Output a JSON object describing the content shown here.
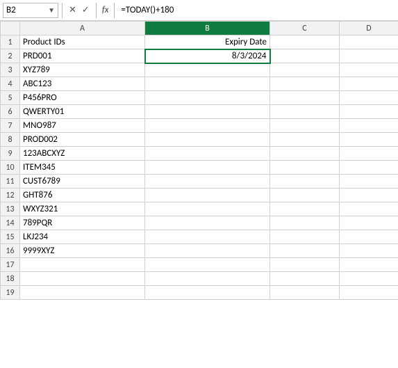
{
  "formulaBar": {
    "nameBox": "B2",
    "icons": [
      "✕",
      "✓",
      "fx"
    ],
    "formula": "=TODAY()+180"
  },
  "columns": {
    "corner": "",
    "headers": [
      "A",
      "B",
      "C",
      "D"
    ]
  },
  "rows": [
    {
      "num": 1,
      "a": "Product IDs",
      "b": "Expiry Date",
      "bClass": ""
    },
    {
      "num": 2,
      "a": "PRD001",
      "b": "8/3/2024",
      "bClass": "selected"
    },
    {
      "num": 3,
      "a": "XYZ789",
      "b": "",
      "bClass": ""
    },
    {
      "num": 4,
      "a": "ABC123",
      "b": "",
      "bClass": ""
    },
    {
      "num": 5,
      "a": "P456PRO",
      "b": "",
      "bClass": ""
    },
    {
      "num": 6,
      "a": "QWERTY01",
      "b": "",
      "bClass": ""
    },
    {
      "num": 7,
      "a": "MNO987",
      "b": "",
      "bClass": ""
    },
    {
      "num": 8,
      "a": "PROD002",
      "b": "",
      "bClass": ""
    },
    {
      "num": 9,
      "a": "123ABCXYZ",
      "b": "",
      "bClass": ""
    },
    {
      "num": 10,
      "a": "ITEM345",
      "b": "",
      "bClass": ""
    },
    {
      "num": 11,
      "a": "CUST6789",
      "b": "",
      "bClass": ""
    },
    {
      "num": 12,
      "a": "GHT876",
      "b": "",
      "bClass": ""
    },
    {
      "num": 13,
      "a": "WXYZ321",
      "b": "",
      "bClass": ""
    },
    {
      "num": 14,
      "a": "789PQR",
      "b": "",
      "bClass": ""
    },
    {
      "num": 15,
      "a": "LKJ234",
      "b": "",
      "bClass": ""
    },
    {
      "num": 16,
      "a": "9999XYZ",
      "b": "",
      "bClass": ""
    },
    {
      "num": 17,
      "a": "",
      "b": "",
      "bClass": ""
    },
    {
      "num": 18,
      "a": "",
      "b": "",
      "bClass": ""
    },
    {
      "num": 19,
      "a": "",
      "b": "",
      "bClass": ""
    }
  ]
}
